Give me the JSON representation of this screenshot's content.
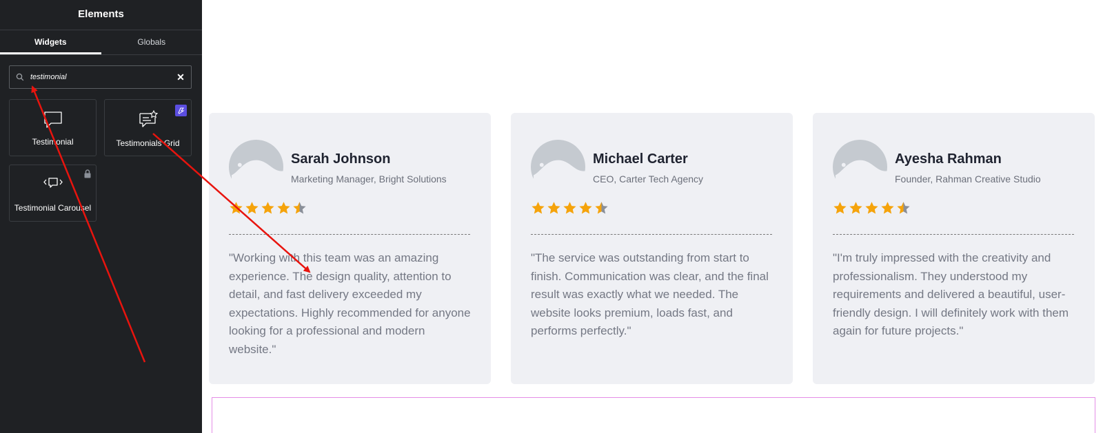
{
  "panel": {
    "title": "Elements",
    "tabs": [
      {
        "label": "Widgets",
        "active": true
      },
      {
        "label": "Globals",
        "active": false
      }
    ],
    "search": {
      "value": "testimonial",
      "clear_icon": "close-icon"
    },
    "widgets": [
      {
        "label": "Testimonial",
        "icon": "speech-bubble-icon"
      },
      {
        "label": "Testimonials Grid",
        "icon": "message-star-icon",
        "badge": "pro-icon"
      },
      {
        "label": "Testimonial Carousel",
        "icon": "carousel-bubble-icon",
        "badge": "lock-icon"
      }
    ],
    "collapse_icon": "chevron-left-icon"
  },
  "testimonials": [
    {
      "name": "Sarah Johnson",
      "role": "Marketing Manager, Bright Solutions",
      "rating": 4.5,
      "quote": "\"Working with this team was an amazing experience. The design quality, attention to detail, and fast delivery exceeded my expectations. Highly recommended for anyone looking for a professional and modern website.\""
    },
    {
      "name": "Michael Carter",
      "role": "CEO, Carter Tech Agency",
      "rating": 4.5,
      "quote": "\"The service was outstanding from start to finish. Communication was clear, and the final result was exactly what we needed. The website looks premium, loads fast, and performs perfectly.\""
    },
    {
      "name": "Ayesha Rahman",
      "role": "Founder, Rahman Creative Studio",
      "rating": 4.5,
      "quote": "\"I'm truly impressed with the creativity and professionalism. They understood my requirements and delivered a beautiful, user-friendly design. I will definitely work with them again for future projects.\""
    }
  ],
  "colors": {
    "panel_bg": "#1f2124",
    "card_bg": "#eff0f4",
    "star": "#f5a30b",
    "star_empty": "#8a8f98",
    "annotation_arrow": "#e8140e",
    "pro_badge": "#5b4ee0",
    "section_outline": "#e48de6"
  }
}
